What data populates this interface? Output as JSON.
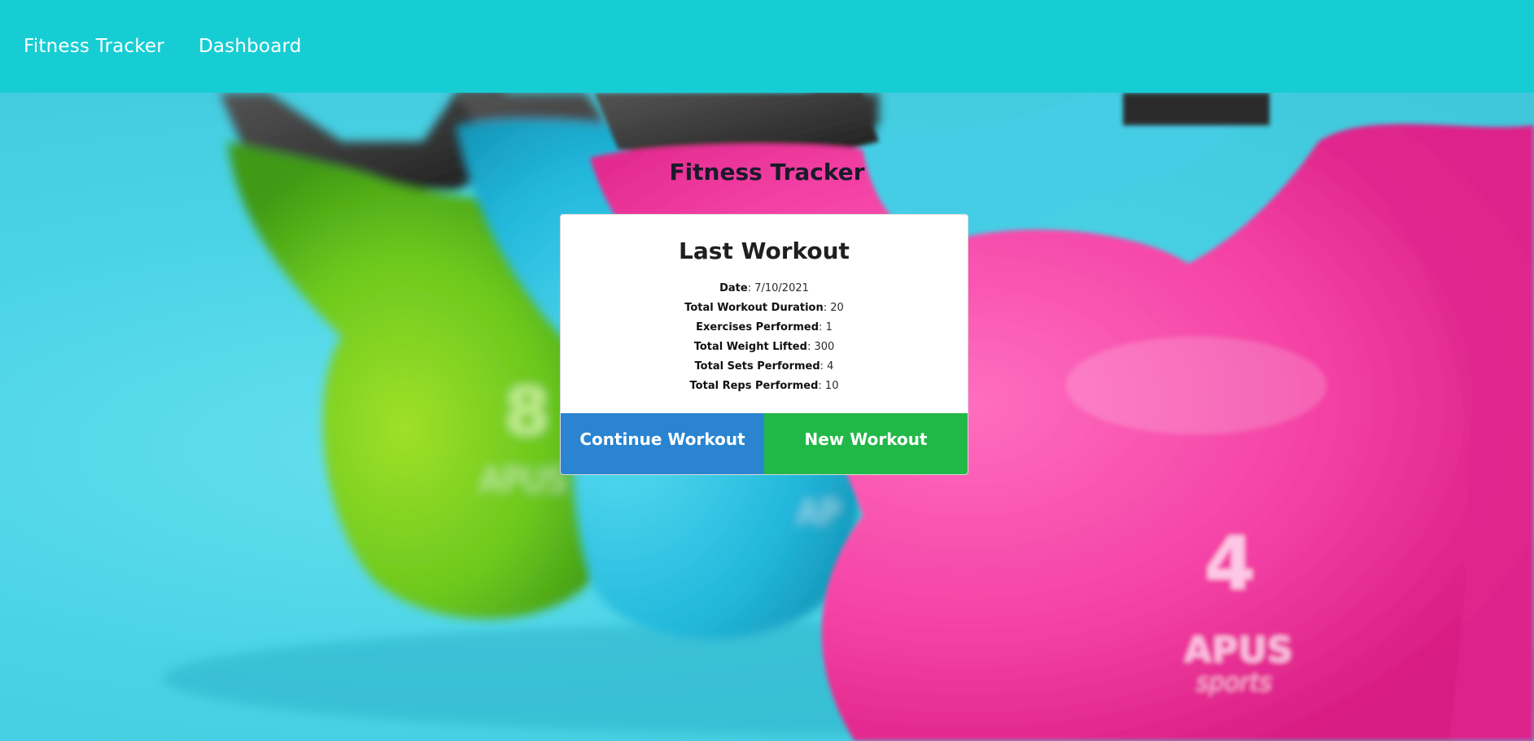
{
  "navbar": {
    "brand": "Fitness Tracker",
    "links": [
      {
        "label": "Dashboard"
      }
    ]
  },
  "page": {
    "title": "Fitness Tracker"
  },
  "last_workout": {
    "title": "Last Workout",
    "stats": [
      {
        "label": "Date",
        "value": "7/10/2021"
      },
      {
        "label": "Total Workout Duration",
        "value": "20"
      },
      {
        "label": "Exercises Performed",
        "value": "1"
      },
      {
        "label": "Total Weight Lifted",
        "value": "300"
      },
      {
        "label": "Total Sets Performed",
        "value": "4"
      },
      {
        "label": "Total Reps Performed",
        "value": "10"
      }
    ],
    "buttons": {
      "continue": "Continue Workout",
      "new": "New Workout"
    }
  },
  "colors": {
    "navbar": "#17cdd4",
    "continue_button": "#2a84d0",
    "new_button": "#22b848"
  }
}
